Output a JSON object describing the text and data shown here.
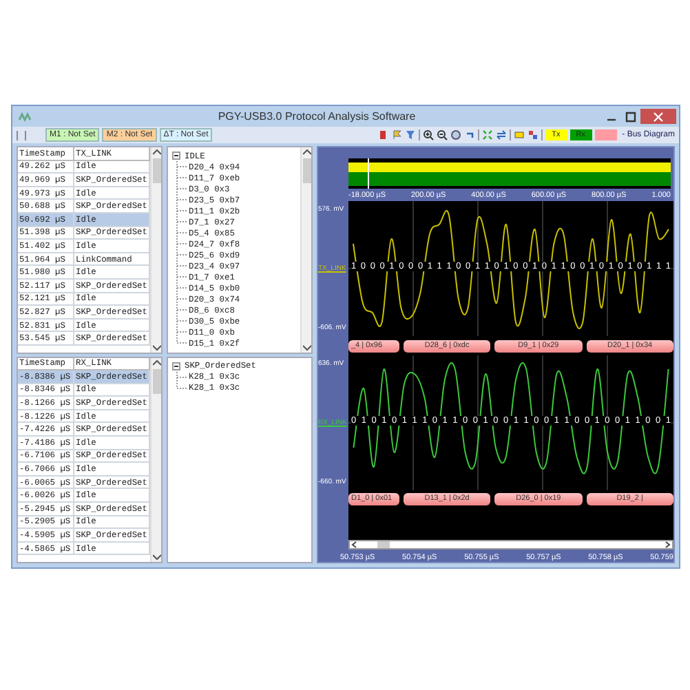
{
  "window": {
    "title": "PGY-USB3.0 Protocol Analysis Software"
  },
  "toolbar": {
    "markers": [
      {
        "label": "M1 : Not Set",
        "color": "#c8f5b4"
      },
      {
        "label": "M2 : Not Set",
        "color": "#ffcf9a"
      },
      {
        "label": "ΔT : Not Set",
        "color": "#d8f0ff"
      }
    ],
    "channel_buttons": [
      {
        "label": "Tx",
        "color": "#ffff00"
      },
      {
        "label": "Rx",
        "color": "#00a000"
      },
      {
        "color": "#ff9aa2"
      }
    ],
    "view_label": "- Bus Diagram"
  },
  "tx_table": {
    "columns": [
      "TimeStamp",
      "TX_LINK"
    ],
    "rows": [
      {
        "cells": [
          "49.262 µS",
          "Idle"
        ],
        "selected": false
      },
      {
        "cells": [
          "49.969 µS",
          "SKP_OrderedSet"
        ],
        "selected": false
      },
      {
        "cells": [
          "49.973 µS",
          "Idle"
        ],
        "selected": false
      },
      {
        "cells": [
          "50.688 µS",
          "SKP_OrderedSet"
        ],
        "selected": false
      },
      {
        "cells": [
          "50.692 µS",
          "Idle"
        ],
        "selected": true
      },
      {
        "cells": [
          "51.398 µS",
          "SKP_OrderedSet"
        ],
        "selected": false
      },
      {
        "cells": [
          "51.402 µS",
          "Idle"
        ],
        "selected": false
      },
      {
        "cells": [
          "51.964 µS",
          "LinkCommand"
        ],
        "selected": false
      },
      {
        "cells": [
          "51.980 µS",
          "Idle"
        ],
        "selected": false
      },
      {
        "cells": [
          "52.117 µS",
          "SKP_OrderedSet"
        ],
        "selected": false
      },
      {
        "cells": [
          "52.121 µS",
          "Idle"
        ],
        "selected": false
      },
      {
        "cells": [
          "52.827 µS",
          "SKP_OrderedSet"
        ],
        "selected": false
      },
      {
        "cells": [
          "52.831 µS",
          "Idle"
        ],
        "selected": false
      },
      {
        "cells": [
          "53.545 µS",
          "SKP_OrderedSet"
        ],
        "selected": false
      }
    ]
  },
  "tx_tree": {
    "label": "IDLE",
    "expanded": true,
    "children": [
      {
        "label": "D20_4 0x94"
      },
      {
        "label": "D11_7 0xeb"
      },
      {
        "label": "D3_0 0x3"
      },
      {
        "label": "D23_5 0xb7"
      },
      {
        "label": "D11_1 0x2b"
      },
      {
        "label": "D7_1 0x27"
      },
      {
        "label": "D5_4 0x85"
      },
      {
        "label": "D24_7 0xf8"
      },
      {
        "label": "D25_6 0xd9"
      },
      {
        "label": "D23_4 0x97"
      },
      {
        "label": "D1_7 0xe1"
      },
      {
        "label": "D14_5 0xb0"
      },
      {
        "label": "D20_3 0x74"
      },
      {
        "label": "D8_6 0xc8"
      },
      {
        "label": "D30_5 0xbe"
      },
      {
        "label": "D11_0 0xb"
      },
      {
        "label": "D15_1 0x2f"
      }
    ]
  },
  "rx_table": {
    "columns": [
      "TimeStamp",
      "RX_LINK"
    ],
    "rows": [
      {
        "cells": [
          "-8.8386 µS",
          "SKP_OrderedSet"
        ],
        "selected": true
      },
      {
        "cells": [
          "-8.8346 µS",
          "Idle"
        ],
        "selected": false
      },
      {
        "cells": [
          "-8.1266 µS",
          "SKP_OrderedSet"
        ],
        "selected": false
      },
      {
        "cells": [
          "-8.1226 µS",
          "Idle"
        ],
        "selected": false
      },
      {
        "cells": [
          "-7.4226 µS",
          "SKP_OrderedSet"
        ],
        "selected": false
      },
      {
        "cells": [
          "-7.4186 µS",
          "Idle"
        ],
        "selected": false
      },
      {
        "cells": [
          "-6.7106 µS",
          "SKP_OrderedSet"
        ],
        "selected": false
      },
      {
        "cells": [
          "-6.7066 µS",
          "Idle"
        ],
        "selected": false
      },
      {
        "cells": [
          "-6.0065 µS",
          "SKP_OrderedSet"
        ],
        "selected": false
      },
      {
        "cells": [
          "-6.0026 µS",
          "Idle"
        ],
        "selected": false
      },
      {
        "cells": [
          "-5.2945 µS",
          "SKP_OrderedSet"
        ],
        "selected": false
      },
      {
        "cells": [
          "-5.2905 µS",
          "Idle"
        ],
        "selected": false
      },
      {
        "cells": [
          "-4.5905 µS",
          "SKP_OrderedSet"
        ],
        "selected": false
      },
      {
        "cells": [
          "-4.5865 µS",
          "Idle"
        ],
        "selected": false
      }
    ]
  },
  "rx_tree": {
    "label": "SKP_OrderedSet",
    "expanded": true,
    "children": [
      {
        "label": "K28_1 0x3c"
      },
      {
        "label": "K28_1 0x3c"
      }
    ]
  },
  "overview": {
    "axis_labels": [
      "-18.000 µS",
      "200.00 µS",
      "400.00 µS",
      "600.00 µS",
      "800.00 µS",
      "1.000"
    ]
  },
  "channels": [
    {
      "name": "TX_LINK",
      "color": "#c8c000",
      "upper": "576. mV",
      "lower": "-606. mV",
      "bits": "1 0 0 0 1 0 0 0 1 1 1 0 0 1 1 0 1 0 0 1 0 1 1 0 0 1 0 1 0 1 0 1 1 1",
      "decodes": [
        "_4 | 0x96",
        "D28_6 | 0xdc",
        "D9_1 | 0x29",
        "D20_1 | 0x34"
      ]
    },
    {
      "name": "RX_LINK",
      "color": "#3cc83c",
      "upper": "636. mV",
      "lower": "-660. mV",
      "bits": "0 1 0 1 0 1 1 1 0 1 1 0 0 1 0 0 1 1 0 0 1 1 0 0 1 0 0 1 1 0 0 1",
      "decodes": [
        "D1_0 | 0x01",
        "D13_1 | 0x2d",
        "D26_0 | 0x19",
        "D19_2 |"
      ]
    }
  ],
  "time_labels": [
    "50.753 µS",
    "50.754 µS",
    "50.755 µS",
    "50.757 µS",
    "50.758 µS",
    "50.759"
  ]
}
